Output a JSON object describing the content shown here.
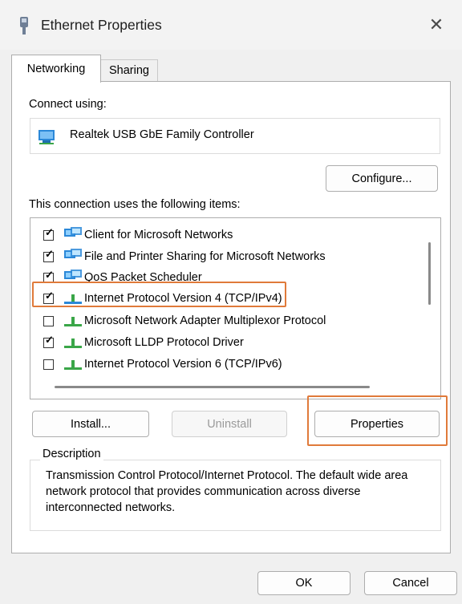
{
  "window": {
    "title": "Ethernet Properties",
    "close_glyph": "✕"
  },
  "tabs": [
    {
      "label": "Networking",
      "active": true
    },
    {
      "label": "Sharing",
      "active": false
    }
  ],
  "connect_using": {
    "label": "Connect using:",
    "adapter": "Realtek USB GbE Family Controller",
    "adapter_icon": "network-adapter-icon"
  },
  "buttons": {
    "configure": "Configure...",
    "install": "Install...",
    "uninstall": "Uninstall",
    "properties": "Properties",
    "ok": "OK",
    "cancel": "Cancel"
  },
  "items_label": "This connection uses the following items:",
  "items": [
    {
      "label": "Client for Microsoft Networks",
      "checked": true,
      "icon": "client-network-icon"
    },
    {
      "label": "File and Printer Sharing for Microsoft Networks",
      "checked": true,
      "icon": "file-printer-sharing-icon"
    },
    {
      "label": "QoS Packet Scheduler",
      "checked": true,
      "icon": "qos-scheduler-icon"
    },
    {
      "label": "Internet Protocol Version 4 (TCP/IPv4)",
      "checked": true,
      "icon": "protocol-icon",
      "highlighted": true
    },
    {
      "label": "Microsoft Network Adapter Multiplexor Protocol",
      "checked": false,
      "icon": "protocol-icon"
    },
    {
      "label": "Microsoft LLDP Protocol Driver",
      "checked": true,
      "icon": "protocol-icon"
    },
    {
      "label": "Internet Protocol Version 6 (TCP/IPv6)",
      "checked": false,
      "icon": "protocol-icon"
    }
  ],
  "description": {
    "title": "Description",
    "text": "Transmission Control Protocol/Internet Protocol. The default wide area network protocol that provides communication across diverse interconnected networks."
  },
  "colors": {
    "highlight": "#e07a3a",
    "accent": "#2b88d8",
    "protocol_green": "#3aa648"
  }
}
